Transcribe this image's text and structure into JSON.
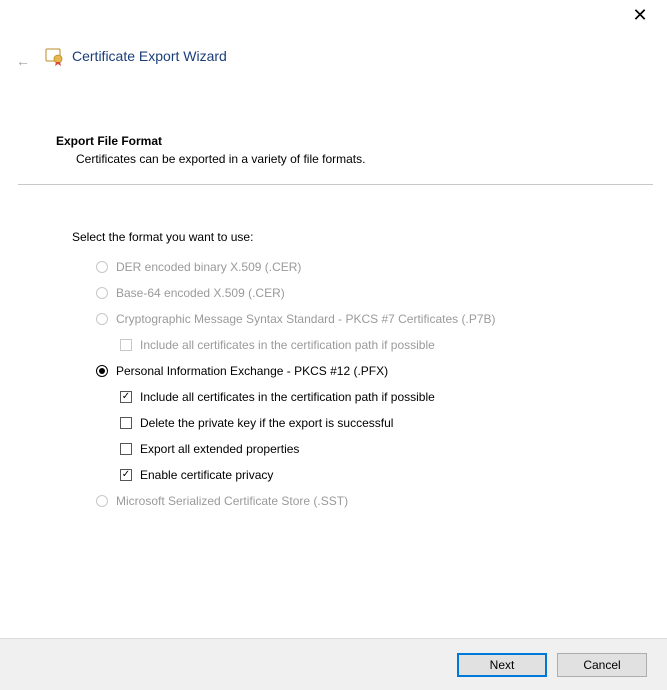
{
  "window": {
    "title": "Certificate Export Wizard"
  },
  "section": {
    "title": "Export File Format",
    "desc": "Certificates can be exported in a variety of file formats."
  },
  "prompt": "Select the format you want to use:",
  "options": {
    "der": "DER encoded binary X.509 (.CER)",
    "b64": "Base-64 encoded X.509 (.CER)",
    "p7b": "Cryptographic Message Syntax Standard - PKCS #7 Certificates (.P7B)",
    "p7b_sub": "Include all certificates in the certification path if possible",
    "pfx": "Personal Information Exchange - PKCS #12 (.PFX)",
    "pfx_sub1": "Include all certificates in the certification path if possible",
    "pfx_sub2": "Delete the private key if the export is successful",
    "pfx_sub3": "Export all extended properties",
    "pfx_sub4": "Enable certificate privacy",
    "sst": "Microsoft Serialized Certificate Store (.SST)"
  },
  "buttons": {
    "next": "Next",
    "cancel": "Cancel"
  }
}
